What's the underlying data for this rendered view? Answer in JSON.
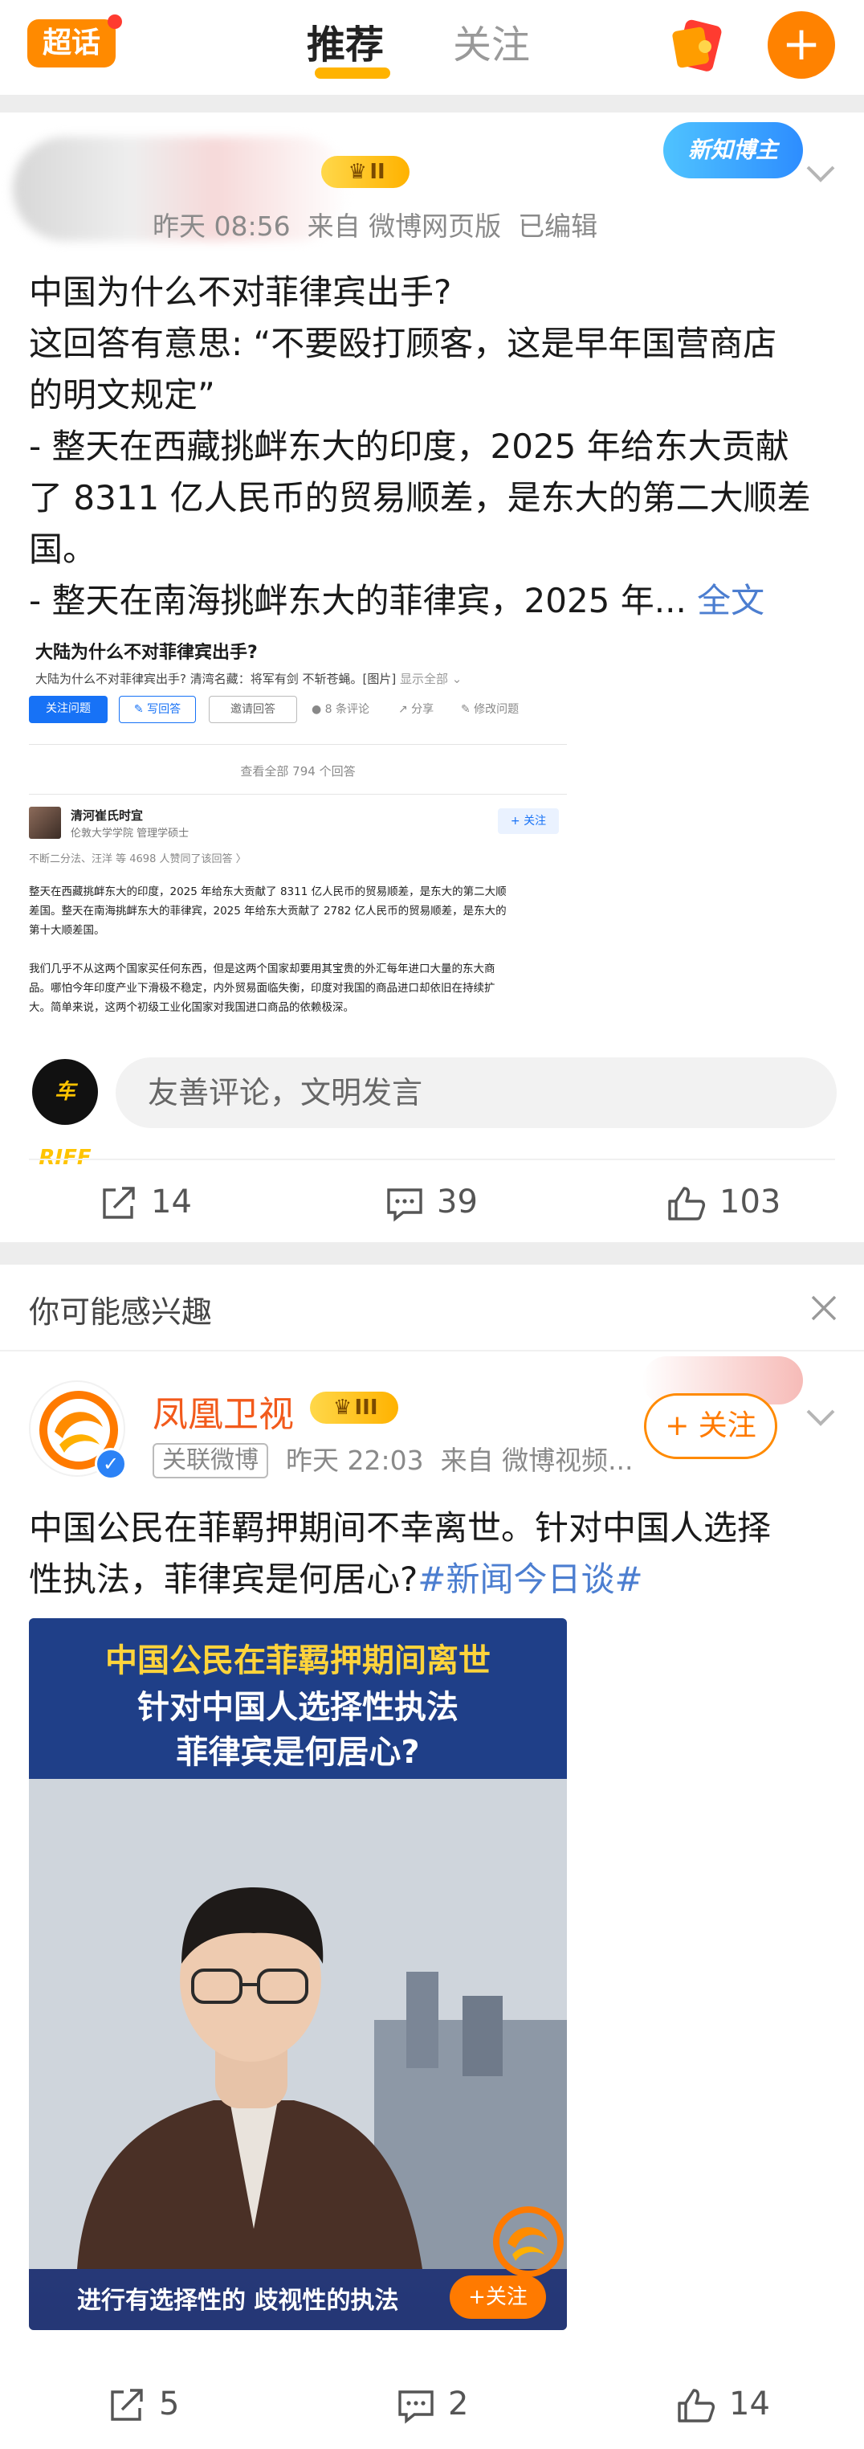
{
  "nav": {
    "logo": "超话",
    "tab_recommend": "推荐",
    "tab_follow": "关注",
    "plus": "+"
  },
  "post1": {
    "medal_level": "II",
    "badge": "新知博主",
    "time": "昨天 08:56",
    "source": "来自 微博网页版",
    "edited": "已编辑",
    "text_lines": [
      "中国为什么不对菲律宾出手?",
      "这回答有意思: “不要殴打顾客，这是早年国营商店",
      "的明文规定”",
      "- 整天在西藏挑衅东大的印度，2025 年给东大贡献",
      "了 8311 亿人民币的贸易顺差，是东大的第二大顺差",
      "国。",
      "- 整天在南海挑衅东大的菲律宾，2025 年..."
    ],
    "full_text_link": "全文",
    "embed": {
      "title": "大陆为什么不对菲律宾出手?",
      "subtitle": "大陆为什么不对菲律宾出手? 清湾名藏：将军有剑 不斩苍蝇。[图片]",
      "subtitle_more": "显示全部 ⌄",
      "btn_follow": "关注问题",
      "btn_write": "✎ 写回答",
      "btn_invite": "邀请回答",
      "link_comments": "● 8 条评论",
      "link_share": "↗ 分享",
      "link_edit": "✎ 修改问题",
      "view_all": "查看全部 794 个回答",
      "author": "清河崔氏时宜",
      "author_desc": "伦敦大学学院 管理学硕士",
      "follow": "+ 关注",
      "likers": "不断二分法、汪洋 等 4698 人赞同了该回答 〉",
      "para1_lines": [
        "整天在西藏挑衅东大的印度，2025 年给东大贡献了 8311 亿人民币的贸易顺差，是东大的第二大顺",
        "差国。整天在南海挑衅东大的菲律宾，2025 年给东大贡献了 2782 亿人民币的贸易顺差，是东大的",
        "第十大顺差国。"
      ],
      "para2_lines": [
        "我们几乎不从这两个国家买任何东西，但是这两个国家却要用其宝贵的外汇每年进口大量的东大商",
        "品。哪怕今年印度产业下滑极不稳定，内外贸易面临失衡，印度对我国的商品进口却依旧在持续扩",
        "大。简单来说，这两个初级工业化国家对我国进口商品的依赖极深。"
      ]
    },
    "commenter_logo": "车 RIFF",
    "comment_placeholder": "友善评论，文明发言",
    "reposts": "14",
    "comments": "39",
    "likes": "103"
  },
  "recommend": {
    "header": "你可能感兴趣",
    "name": "凤凰卫视",
    "medal_level": "III",
    "tag": "关联微博",
    "time": "昨天 22:03",
    "source": "来自 微博视频...",
    "follow": "+ 关注",
    "text_lines": [
      "中国公民在菲羁押期间不幸离世。针对中国人选择",
      "性执法，菲律宾是何居心?"
    ],
    "hashtag": "#新闻今日谈#",
    "video": {
      "line1": "中国公民在菲羁押期间离世",
      "line2": "针对中国人选择性执法",
      "line3": "菲律宾是何居心?",
      "subtitle": "进行有选择性的 歧视性的执法",
      "follow": "+关注"
    },
    "reposts": "5",
    "comments": "2",
    "likes": "14"
  }
}
